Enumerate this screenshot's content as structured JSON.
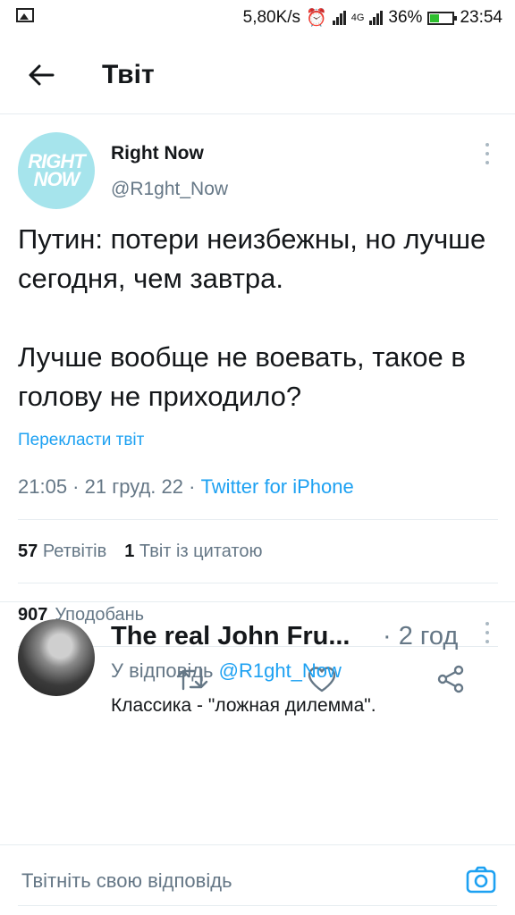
{
  "status_bar": {
    "speed": "5,80K/s",
    "network": "4G",
    "battery": "36%",
    "time": "23:54"
  },
  "header": {
    "title": "Твіт"
  },
  "tweet": {
    "author_name": "Right Now",
    "author_handle": "@R1ght_Now",
    "avatar_logo": "RIGHT NOW",
    "text_line1": "Путин: потери неизбежны, но лучше сегодня, чем завтра.",
    "text_line2": "Лучше вообще не воевать, такое в голову не приходило?",
    "translate_label": "Перекласти твіт",
    "timestamp": "21:05 · 21 груд. 22 · ",
    "source": "Twitter for iPhone",
    "retweets_count": "57",
    "retweets_label": "Ретвітів",
    "quotes_count": "1",
    "quotes_label": "Твіт із цитатою",
    "likes_count": "907",
    "likes_label": "Уподобань"
  },
  "reply": {
    "author_name": "The real John Fru...",
    "time": "· 2 год",
    "reply_prefix": "У відповідь ",
    "reply_handle": "@R1ght_Now",
    "text": "Классика - \"ложная дилемма\"."
  },
  "compose": {
    "placeholder": "Твітніть свою відповідь"
  },
  "colors": {
    "accent": "#1da1f2",
    "secondary_text": "#657786",
    "divider": "#e6ecf0",
    "avatar_bg": "#a6e4ec"
  },
  "icons": [
    "back-arrow-icon",
    "more-icon",
    "reply-icon",
    "retweet-icon",
    "like-icon",
    "share-icon",
    "camera-icon"
  ]
}
